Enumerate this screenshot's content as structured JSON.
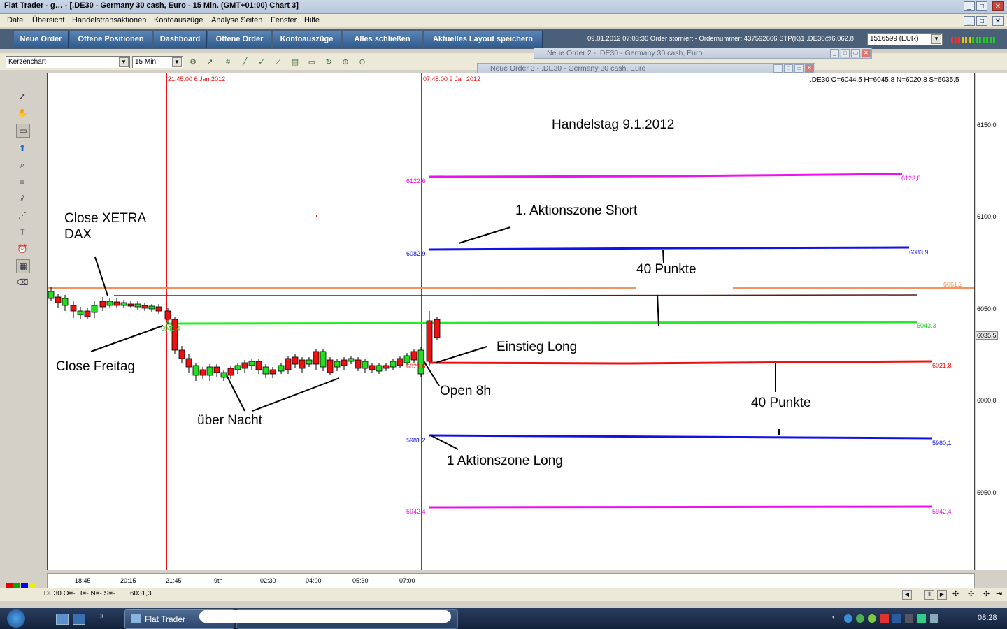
{
  "window": {
    "title": "Flat Trader - g… - [.DE30 - Germany 30 cash, Euro - 15 Min. (GMT+01:00)   Chart 3]"
  },
  "menu": [
    "Datei",
    "Übersicht",
    "Handelstransaktionen",
    "Kontoauszüge",
    "Analyse Seiten",
    "Fenster",
    "Hilfe"
  ],
  "nav_buttons": [
    "Neue Order",
    "Offene Positionen",
    "Dashboard",
    "Offene Order",
    "Kontoauszüge",
    "Alles schließen",
    "Aktuelles Layout speichern"
  ],
  "status_message": "09.01.2012 07:03:36 Order storniert - Ordernummer: 437592666 STP(K)1 .DE30@6.062,8",
  "account": "1516599 (EUR)",
  "chart_type_select": "Kerzenchart",
  "timeframe_select": "15 Min.",
  "floating_windows": [
    {
      "title": "Neue Order 2 - .DE30 - Germany 30 cash, Euro"
    },
    {
      "title": "Neue Order 3 - .DE30 - Germany 30 cash, Euro"
    }
  ],
  "chart": {
    "ohlc_header": ".DE30 O=6044,5 H=6045,8 N=6020,8 S=6035,5",
    "title_annotation": "Handelstag 9.1.2012",
    "vlines": [
      {
        "label": "21:45:00 6 Jan 2012",
        "color": "#ee1111"
      },
      {
        "label": "07:45:00 9 Jan 2012",
        "color": "#ee1111"
      }
    ],
    "current_price": "6035,5",
    "price_ticks": [
      "6150,0",
      "6100,0",
      "6050,0",
      "6000,0",
      "5950,0"
    ],
    "time_ticks": [
      "18:45",
      "20:15",
      "21:45",
      "9th",
      "02:30",
      "04:00",
      "05:30",
      "07:00"
    ],
    "levels": [
      {
        "name": "magenta-upper",
        "left": "6122,6",
        "right": "6123,8",
        "color": "#ee11ee"
      },
      {
        "name": "blue-upper",
        "left": "6082,9",
        "right": "6083,9",
        "color": "#1111ee"
      },
      {
        "name": "orange",
        "left": "",
        "right": "6061,2",
        "color": "#f59060"
      },
      {
        "name": "green",
        "left": "6041,4",
        "right": "6043,3",
        "color": "#22ee22"
      },
      {
        "name": "red",
        "left": "6021,6",
        "right": "6021,8",
        "color": "#ee1111"
      },
      {
        "name": "blue-lower",
        "left": "5981,2",
        "right": "5980,1",
        "color": "#1111ee"
      },
      {
        "name": "magenta-lower",
        "left": "5942,4",
        "right": "5942,4",
        "color": "#ee11ee"
      }
    ],
    "annotations": {
      "close_xetra": "Close XETRA DAX",
      "close_xetra_line1": "Close XETRA",
      "close_xetra_line2": "DAX",
      "close_freitag": "Close Freitag",
      "ueber_nacht": "über Nacht",
      "aktionszone_short": "1. Aktionszone Short",
      "punkte_upper": "40 Punkte",
      "einstieg_long": "Einstieg Long",
      "open_8h": "Open 8h",
      "punkte_lower": "40 Punkte",
      "aktionszone_long": "1 Aktionszone Long"
    }
  },
  "bottom_status": {
    "quote": ".DE30 O=- H=- N=- S=-",
    "value": "6031,3"
  },
  "taskbar": {
    "app": "Flat Trader",
    "clock": "08:28"
  },
  "colors": {
    "nav_bg": "#4a5f78",
    "bull": "#22dd22",
    "bear": "#ee1111"
  }
}
